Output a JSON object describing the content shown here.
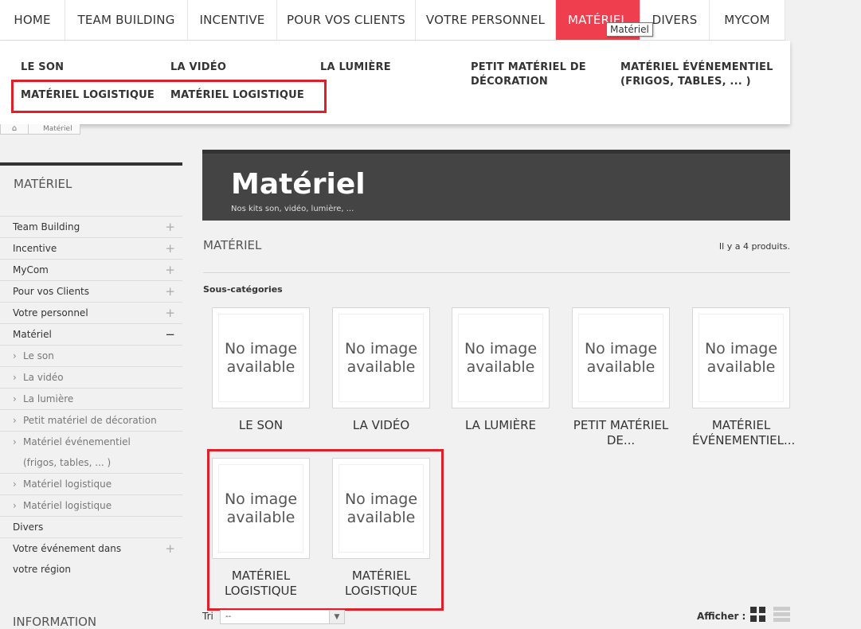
{
  "nav": [
    {
      "label": "HOME",
      "width": 82
    },
    {
      "label": "TEAM BUILDING",
      "width": 154
    },
    {
      "label": "INCENTIVE",
      "width": 112
    },
    {
      "label": "POUR VOS CLIENTS",
      "width": 174
    },
    {
      "label": "VOTRE PERSONNEL",
      "width": 176
    },
    {
      "label": "MATÉRIEL",
      "width": 106,
      "active": true
    },
    {
      "label": "DIVERS",
      "width": 87
    },
    {
      "label": "MYCOM",
      "width": 95
    }
  ],
  "tooltip": "Matériel",
  "dropdown": [
    "LE SON",
    "LA VIDÉO",
    "LA LUMIÈRE",
    "PETIT MATÉRIEL DE DÉCORATION",
    "MATÉRIEL ÉVÉNEMENTIEL (FRIGOS, TABLES, ... )",
    "MATÉRIEL LOGISTIQUE",
    "MATÉRIEL LOGISTIQUE"
  ],
  "breadcrumb": {
    "current": "Matériel"
  },
  "sidebar": {
    "title": "MATÉRIEL",
    "items": [
      {
        "label": "Team Building",
        "sub": false,
        "toggle": "+"
      },
      {
        "label": "Incentive",
        "sub": false,
        "toggle": "+"
      },
      {
        "label": "MyCom",
        "sub": false,
        "toggle": "+"
      },
      {
        "label": "Pour vos Clients",
        "sub": false,
        "toggle": "+"
      },
      {
        "label": "Votre personnel",
        "sub": false,
        "toggle": "+"
      },
      {
        "label": "Matériel",
        "sub": false,
        "toggle": "−"
      },
      {
        "label": "Le son",
        "sub": true,
        "toggle": ""
      },
      {
        "label": "La vidéo",
        "sub": true,
        "toggle": ""
      },
      {
        "label": "La lumière",
        "sub": true,
        "toggle": ""
      },
      {
        "label": "Petit matériel de décoration",
        "sub": true,
        "toggle": ""
      },
      {
        "label": "Matériel événementiel (frigos, tables, ... )",
        "sub": true,
        "toggle": ""
      },
      {
        "label": "Matériel logistique",
        "sub": true,
        "toggle": ""
      },
      {
        "label": "Matériel logistique",
        "sub": true,
        "toggle": ""
      },
      {
        "label": "Divers",
        "sub": false,
        "toggle": ""
      },
      {
        "label": "Votre événement dans votre région",
        "sub": false,
        "toggle": "+"
      }
    ],
    "info_title": "INFORMATION"
  },
  "hero": {
    "title": "Matériel",
    "subtitle": "Nos kits son, vidéo, lumière, ..."
  },
  "main": {
    "heading": "MATÉRIEL",
    "count": "Il y a 4 produits.",
    "subcat_label": "Sous-catégories",
    "no_image": "No image available",
    "subcategories": [
      "LE SON",
      "LA VIDÉO",
      "LA LUMIÈRE",
      "PETIT MATÉRIEL DE...",
      "MATÉRIEL ÉVÉNEMENTIEL...",
      "MATÉRIEL LOGISTIQUE",
      "MATÉRIEL LOGISTIQUE"
    ]
  },
  "sort": {
    "label": "Tri",
    "value": "--"
  },
  "view": {
    "label": "Afficher :"
  },
  "colors": {
    "accent": "#ef3f4f",
    "highlight": "#e01f28",
    "hero": "#444444"
  },
  "icons": [
    "home-icon",
    "chevron-right-icon",
    "plus-icon",
    "minus-icon",
    "grid-view-icon",
    "list-view-icon",
    "dropdown-arrow-icon"
  ]
}
